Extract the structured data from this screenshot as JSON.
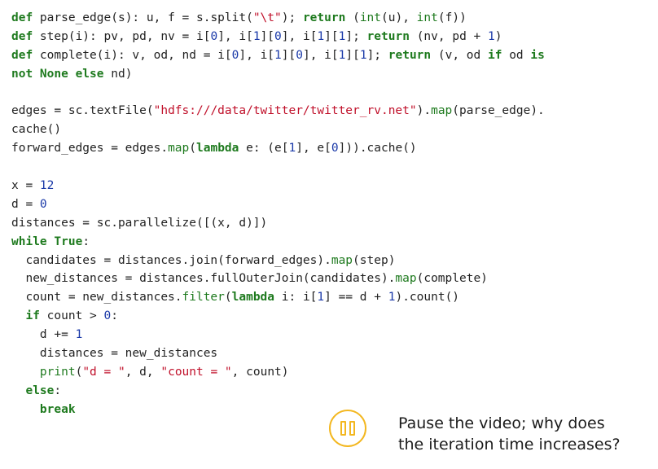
{
  "code_lines": [
    [
      [
        "kw",
        "def"
      ],
      [
        "t",
        " parse_edge(s): u, f = s.split("
      ],
      [
        "str",
        "\"\\t\""
      ],
      [
        "t",
        "); "
      ],
      [
        "kw",
        "return"
      ],
      [
        "t",
        " ("
      ],
      [
        "bi",
        "int"
      ],
      [
        "t",
        "(u), "
      ],
      [
        "bi",
        "int"
      ],
      [
        "t",
        "(f))"
      ]
    ],
    [
      [
        "kw",
        "def"
      ],
      [
        "t",
        " step(i): pv, pd, nv = i["
      ],
      [
        "num",
        "0"
      ],
      [
        "t",
        "], i["
      ],
      [
        "num",
        "1"
      ],
      [
        "t",
        "]["
      ],
      [
        "num",
        "0"
      ],
      [
        "t",
        "], i["
      ],
      [
        "num",
        "1"
      ],
      [
        "t",
        "]["
      ],
      [
        "num",
        "1"
      ],
      [
        "t",
        "]; "
      ],
      [
        "kw",
        "return"
      ],
      [
        "t",
        " (nv, pd + "
      ],
      [
        "num",
        "1"
      ],
      [
        "t",
        ")"
      ]
    ],
    [
      [
        "kw",
        "def"
      ],
      [
        "t",
        " complete(i): v, od, nd = i["
      ],
      [
        "num",
        "0"
      ],
      [
        "t",
        "], i["
      ],
      [
        "num",
        "1"
      ],
      [
        "t",
        "]["
      ],
      [
        "num",
        "0"
      ],
      [
        "t",
        "], i["
      ],
      [
        "num",
        "1"
      ],
      [
        "t",
        "]["
      ],
      [
        "num",
        "1"
      ],
      [
        "t",
        "]; "
      ],
      [
        "kw",
        "return"
      ],
      [
        "t",
        " (v, od "
      ],
      [
        "kw",
        "if"
      ],
      [
        "t",
        " od "
      ],
      [
        "kw",
        "is"
      ]
    ],
    [
      [
        "kw",
        "not None"
      ],
      [
        "t",
        " "
      ],
      [
        "kw",
        "else"
      ],
      [
        "t",
        " nd)"
      ]
    ],
    [],
    [
      [
        "t",
        "edges = sc.textFile("
      ],
      [
        "str",
        "\"hdfs:///data/twitter/twitter_rv.net\""
      ],
      [
        "t",
        ")."
      ],
      [
        "bi",
        "map"
      ],
      [
        "t",
        "(parse_edge)."
      ]
    ],
    [
      [
        "t",
        "cache()"
      ]
    ],
    [
      [
        "t",
        "forward_edges = edges."
      ],
      [
        "bi",
        "map"
      ],
      [
        "t",
        "("
      ],
      [
        "kw",
        "lambda"
      ],
      [
        "t",
        " e: (e["
      ],
      [
        "num",
        "1"
      ],
      [
        "t",
        "], e["
      ],
      [
        "num",
        "0"
      ],
      [
        "t",
        "])).cache()"
      ]
    ],
    [],
    [
      [
        "t",
        "x = "
      ],
      [
        "num",
        "12"
      ]
    ],
    [
      [
        "t",
        "d = "
      ],
      [
        "num",
        "0"
      ]
    ],
    [
      [
        "t",
        "distances = sc.parallelize([(x, d)])"
      ]
    ],
    [
      [
        "kw",
        "while True"
      ],
      [
        "t",
        ":"
      ]
    ],
    [
      [
        "t",
        "  candidates = distances.join(forward_edges)."
      ],
      [
        "bi",
        "map"
      ],
      [
        "t",
        "(step)"
      ]
    ],
    [
      [
        "t",
        "  new_distances = distances.fullOuterJoin(candidates)."
      ],
      [
        "bi",
        "map"
      ],
      [
        "t",
        "(complete)"
      ]
    ],
    [
      [
        "t",
        "  count = new_distances."
      ],
      [
        "bi",
        "filter"
      ],
      [
        "t",
        "("
      ],
      [
        "kw",
        "lambda"
      ],
      [
        "t",
        " i: i["
      ],
      [
        "num",
        "1"
      ],
      [
        "t",
        "] == d + "
      ],
      [
        "num",
        "1"
      ],
      [
        "t",
        ").count()"
      ]
    ],
    [
      [
        "t",
        "  "
      ],
      [
        "kw",
        "if"
      ],
      [
        "t",
        " count > "
      ],
      [
        "num",
        "0"
      ],
      [
        "t",
        ":"
      ]
    ],
    [
      [
        "t",
        "    d += "
      ],
      [
        "num",
        "1"
      ]
    ],
    [
      [
        "t",
        "    distances = new_distances"
      ]
    ],
    [
      [
        "t",
        "    "
      ],
      [
        "bi",
        "print"
      ],
      [
        "t",
        "("
      ],
      [
        "str",
        "\"d = \""
      ],
      [
        "t",
        ", d, "
      ],
      [
        "str",
        "\"count = \""
      ],
      [
        "t",
        ", count)"
      ]
    ],
    [
      [
        "t",
        "  "
      ],
      [
        "kw",
        "else"
      ],
      [
        "t",
        ":"
      ]
    ],
    [
      [
        "t",
        "    "
      ],
      [
        "kw",
        "break"
      ]
    ]
  ],
  "note": {
    "line1": "Pause the video; why does",
    "line2": "the iteration time increases?"
  },
  "colors": {
    "keyword": "#1e7a1e",
    "string": "#c0102a",
    "number": "#1a39a8",
    "accent": "#f3b71f"
  },
  "icons": {
    "pause": "pause-icon"
  }
}
